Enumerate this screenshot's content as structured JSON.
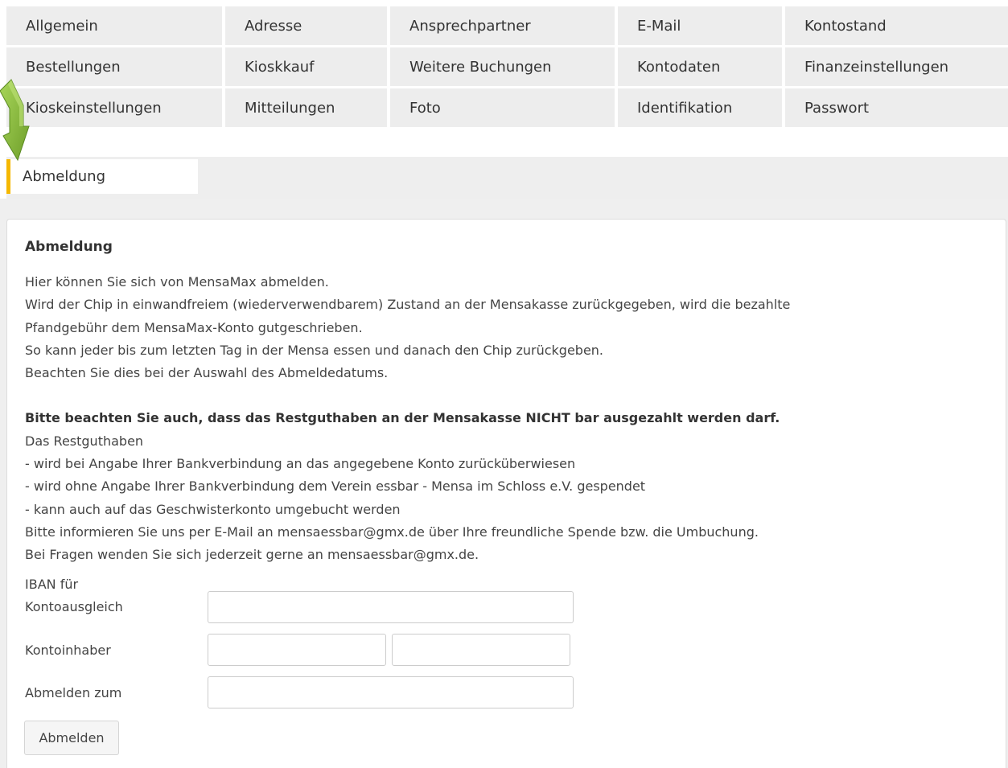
{
  "tabs": [
    [
      "Allgemein",
      "Adresse",
      "Ansprechpartner",
      "E-Mail",
      "Kontostand"
    ],
    [
      "Bestellungen",
      "Kioskkauf",
      "Weitere Buchungen",
      "Kontodaten",
      "Finanzeinstellungen"
    ],
    [
      "Kioskeinstellungen",
      "Mitteilungen",
      "Foto",
      "Identifikation",
      "Passwort"
    ]
  ],
  "active_tab": {
    "label": "Abmeldung",
    "accent_color": "#f5b800"
  },
  "annotation_arrow": {
    "icon": "arrow-down-icon",
    "color": "#8dc63f"
  },
  "panel": {
    "title": "Abmeldung",
    "paragraphs": [
      "Hier können Sie sich von MensaMax abmelden.",
      "Wird der Chip in einwandfreiem (wiederverwendbarem) Zustand an der Mensakasse zurückgegeben, wird die bezahlte",
      "Pfandgebühr dem MensaMax-Konto gutgeschrieben.",
      "So kann jeder bis zum letzten Tag in der Mensa essen und danach den Chip zurückgeben.",
      "Beachten Sie dies bei der Auswahl des Abmeldedatums."
    ],
    "notice_bold": "Bitte beachten Sie auch, dass das Restguthaben an der Mensakasse NICHT bar ausgezahlt werden darf.",
    "notice_lines": [
      "Das Restguthaben",
      "- wird bei Angabe Ihrer Bankverbindung an das angegebene Konto zurücküberwiesen",
      "- wird ohne Angabe Ihrer Bankverbindung dem Verein essbar - Mensa im Schloss e.V. gespendet",
      "- kann auch auf das Geschwisterkonto umgebucht werden",
      "Bitte informieren Sie uns per E-Mail an mensaessbar@gmx.de über Ihre freundliche Spende bzw. die Umbuchung.",
      "Bei Fragen wenden Sie sich jederzeit gerne an mensaessbar@gmx.de."
    ],
    "form": {
      "iban_label_line1": "IBAN für",
      "iban_label_line2": "Kontoausgleich",
      "iban_value": "",
      "holder_label": "Kontoinhaber",
      "holder_first_value": "",
      "holder_last_value": "",
      "date_label": "Abmelden zum",
      "date_value": "",
      "submit_label": "Abmelden"
    }
  }
}
